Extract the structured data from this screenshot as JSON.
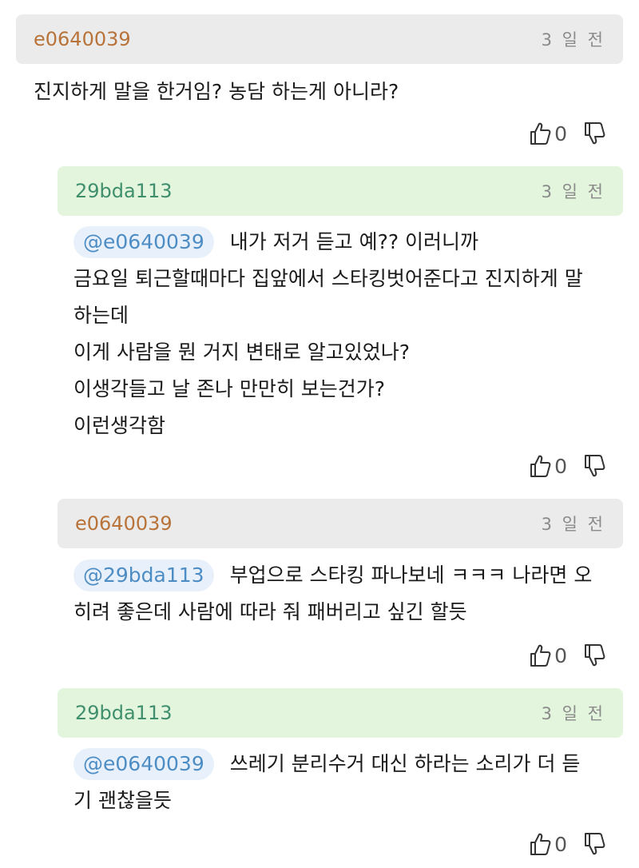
{
  "comments": [
    {
      "author": "e0640039",
      "time": "3 일 전",
      "mention": "",
      "lines": [
        "진지하게 말을 한거임? 농담 하는게 아니라?"
      ],
      "likes": "0"
    },
    {
      "author": "29bda113",
      "time": "3 일 전",
      "mention": "@e0640039",
      "lines": [
        "내가 저거 듣고 예?? 이러니까",
        "금요일 퇴근할때마다 집앞에서 스타킹벗어준다고 진지하게 말",
        "하는데",
        "이게 사람을 뭔 거지 변태로 알고있었나?",
        "이생각들고 날 존나 만만히 보는건가?",
        "이런생각함"
      ],
      "likes": "0"
    },
    {
      "author": "e0640039",
      "time": "3 일 전",
      "mention": "@29bda113",
      "lines": [
        "부업으로 스타킹 파나보네 ㅋㅋㅋ 나라면 오",
        "히려 좋은데 사람에 따라 줘 패버리고 싶긴 할듯"
      ],
      "likes": "0"
    },
    {
      "author": "29bda113",
      "time": "3 일 전",
      "mention": "@e0640039",
      "lines": [
        "쓰레기 분리수거 대신 하라는 소리가 더 듣",
        "기 괜찮을듯"
      ],
      "likes": "0"
    }
  ],
  "icons": {
    "like": "thumbs-up-icon",
    "dislike": "thumbs-down-icon"
  }
}
